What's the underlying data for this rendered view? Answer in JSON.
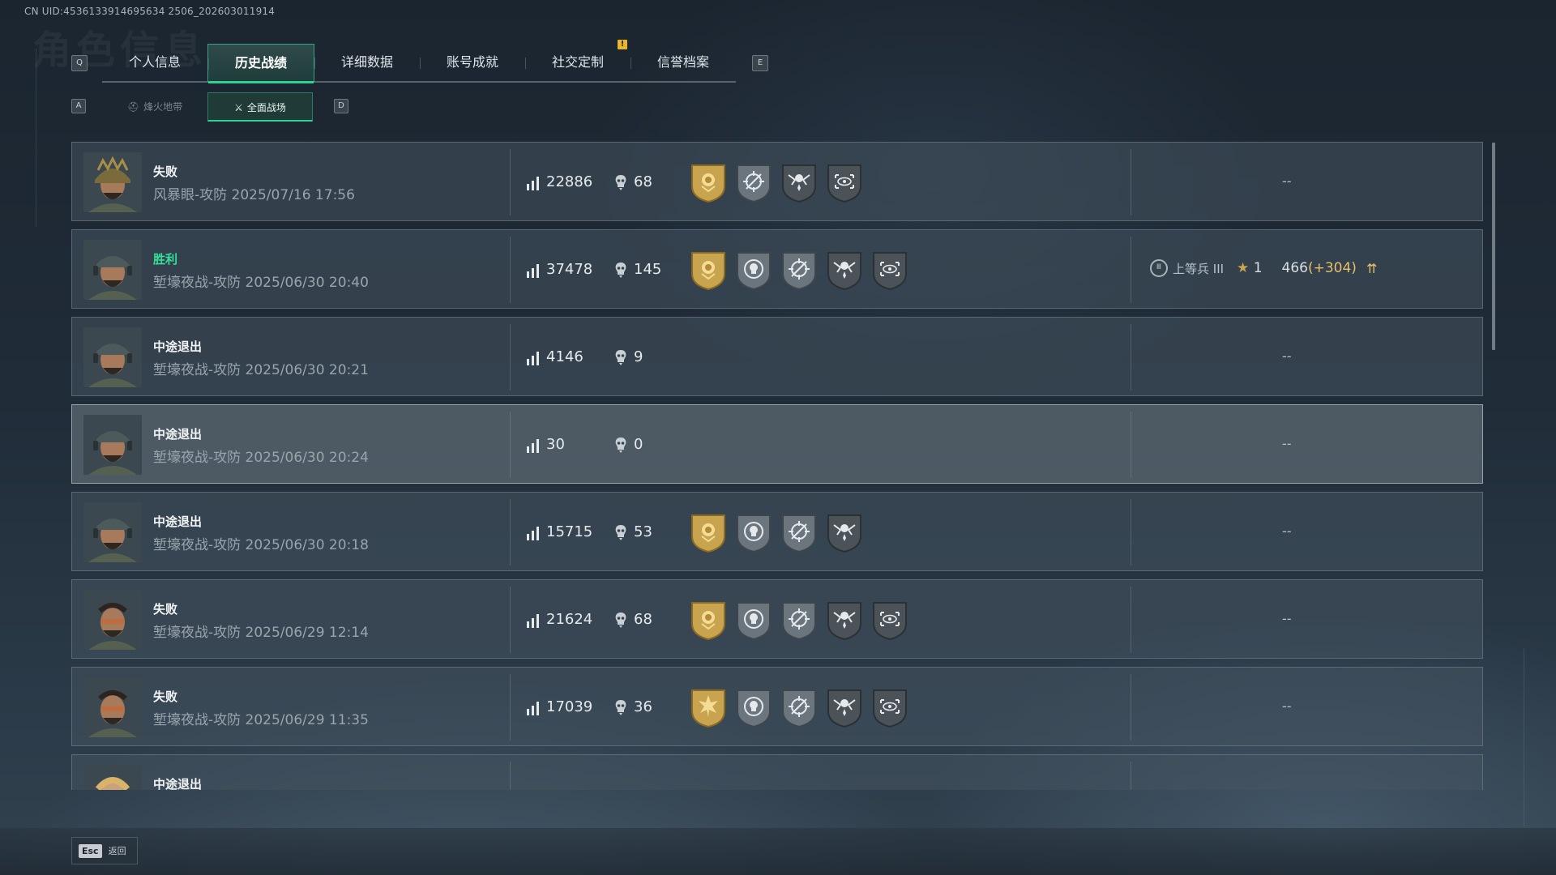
{
  "uid": "CN UID:4536133914695634 2506_202603011914",
  "header_bg_title": "角色信息",
  "tabs": {
    "prev_key": "Q",
    "next_key": "E",
    "items": [
      {
        "label": "个人信息",
        "active": false
      },
      {
        "label": "历史战绩",
        "active": true
      },
      {
        "label": "详细数据",
        "active": false
      },
      {
        "label": "账号成就",
        "active": false
      },
      {
        "label": "社交定制",
        "active": false
      },
      {
        "label": "信誉档案",
        "active": false
      }
    ],
    "notice_badge": "!"
  },
  "subtabs": {
    "prev_key": "A",
    "next_key": "D",
    "items": [
      {
        "label": "烽火地带",
        "active": false
      },
      {
        "label": "全面战场",
        "active": true
      }
    ]
  },
  "matches": [
    {
      "result": "失败",
      "win": false,
      "map_mode": "风暴眼-攻防",
      "datetime": "2025/07/16 17:56",
      "score": "22886",
      "kills": "68",
      "medals": [
        "gold-rose-medal-icon",
        "crosshair-medal-icon",
        "skull-wings-medal-icon",
        "scope-eye-medal-icon"
      ],
      "rank": null,
      "avatar_variant": "camo-helmet",
      "highlight": false
    },
    {
      "result": "胜利",
      "win": true,
      "map_mode": "堑壕夜战-攻防",
      "datetime": "2025/06/30 20:40",
      "score": "37478",
      "kills": "145",
      "medals": [
        "gold-rose-medal-icon",
        "skull-target-medal-icon",
        "crosshair-medal-icon",
        "skull-wings-medal-icon",
        "scope-eye-medal-icon"
      ],
      "rank": {
        "title": "上等兵 III",
        "level": "1",
        "xp": "466",
        "gain": "(+304)"
      },
      "avatar_variant": "cap-headset",
      "highlight": false
    },
    {
      "result": "中途退出",
      "win": false,
      "map_mode": "堑壕夜战-攻防",
      "datetime": "2025/06/30 20:21",
      "score": "4146",
      "kills": "9",
      "medals": [],
      "rank": null,
      "avatar_variant": "cap-headset",
      "highlight": false
    },
    {
      "result": "中途退出",
      "win": false,
      "map_mode": "堑壕夜战-攻防",
      "datetime": "2025/06/30 20:24",
      "score": "30",
      "kills": "0",
      "medals": [],
      "rank": null,
      "avatar_variant": "cap-headset",
      "highlight": true
    },
    {
      "result": "中途退出",
      "win": false,
      "map_mode": "堑壕夜战-攻防",
      "datetime": "2025/06/30 20:18",
      "score": "15715",
      "kills": "53",
      "medals": [
        "gold-rose-medal-icon",
        "skull-target-medal-icon",
        "crosshair-medal-icon",
        "skull-wings-medal-icon"
      ],
      "rank": null,
      "avatar_variant": "cap-headset",
      "highlight": false
    },
    {
      "result": "失败",
      "win": false,
      "map_mode": "堑壕夜战-攻防",
      "datetime": "2025/06/29 12:14",
      "score": "21624",
      "kills": "68",
      "medals": [
        "gold-rose-medal-icon",
        "skull-target-medal-icon",
        "crosshair-medal-icon",
        "skull-wings-medal-icon",
        "scope-eye-medal-icon"
      ],
      "rank": null,
      "avatar_variant": "glasses-beard",
      "highlight": false
    },
    {
      "result": "失败",
      "win": false,
      "map_mode": "堑壕夜战-攻防",
      "datetime": "2025/06/29 11:35",
      "score": "17039",
      "kills": "36",
      "medals": [
        "gold-burst-medal-icon",
        "skull-target-medal-icon",
        "crosshair-medal-icon",
        "skull-wings-medal-icon",
        "scope-eye-medal-icon"
      ],
      "rank": null,
      "avatar_variant": "glasses-beard",
      "highlight": false
    },
    {
      "result": "中途退出",
      "win": false,
      "map_mode": "",
      "datetime": "",
      "score": "",
      "kills": "",
      "medals": [],
      "rank": null,
      "avatar_variant": "blond",
      "highlight": false
    }
  ],
  "empty_placeholder": "--",
  "footer": {
    "key": "Esc",
    "label": "返回"
  },
  "colors": {
    "win": "#33e09a",
    "accent": "#2fd191",
    "gold_gain": "#e7c06b",
    "notice": "#e8b52b"
  }
}
